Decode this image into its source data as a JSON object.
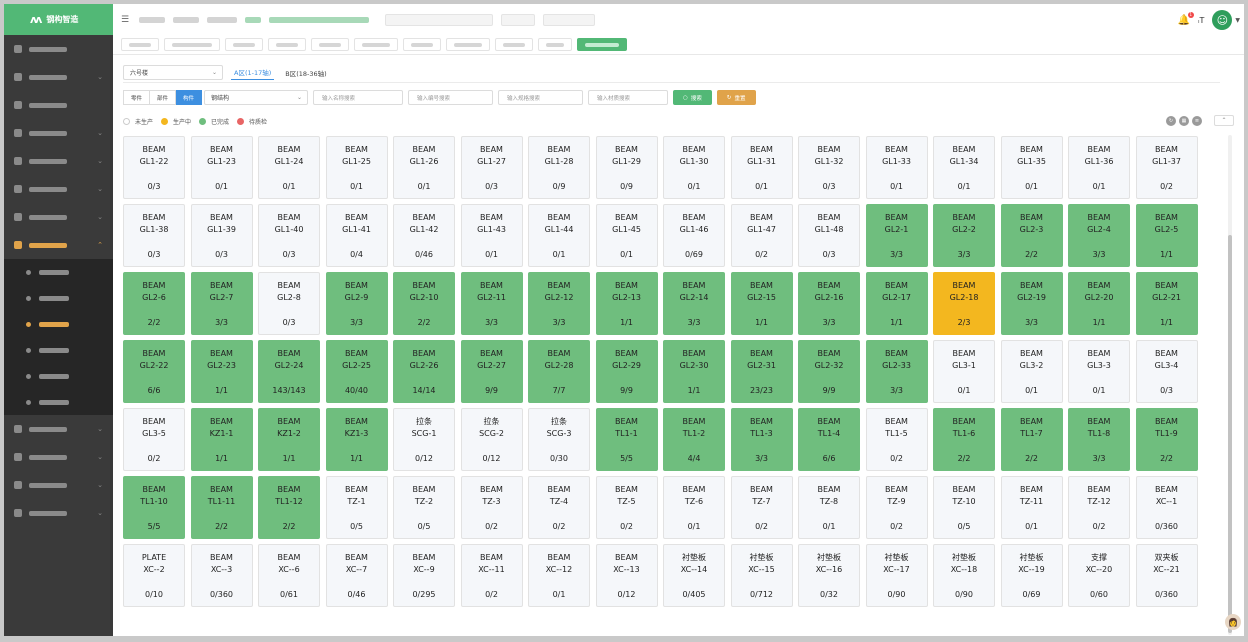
{
  "app": {
    "title": "钢构智造"
  },
  "header": {
    "notifications_count": "1",
    "text_size_label": "T"
  },
  "filters": {
    "building_select": "六号楼",
    "zones": [
      "A区(1-17轴)",
      "B区(18-36轴)"
    ],
    "active_zone": 0,
    "segments": [
      "零件",
      "部件",
      "构件"
    ],
    "active_segment": 2,
    "type_select": "钢结构",
    "inputs": [
      {
        "placeholder": "输入名称搜索"
      },
      {
        "placeholder": "输入编号搜索"
      },
      {
        "placeholder": "输入规格搜索"
      },
      {
        "placeholder": "输入材质搜索"
      }
    ],
    "search_button": "搜索",
    "reset_button": "重置"
  },
  "legend": [
    {
      "label": "未生产",
      "color": "#ffffff"
    },
    {
      "label": "生产中",
      "color": "#f3b71f"
    },
    {
      "label": "已完成",
      "color": "#6fbe7e"
    },
    {
      "label": "待质检",
      "color": "#e86565"
    }
  ],
  "colors": {
    "brand": "#52b876",
    "in_progress": "#f3b71f",
    "done": "#6fbe7e",
    "active_blue": "#3d8fe0"
  },
  "cells": [
    {
      "l1": "BEAM",
      "l2": "GL1-22",
      "count": "0/3",
      "status": "none"
    },
    {
      "l1": "BEAM",
      "l2": "GL1-23",
      "count": "0/1",
      "status": "none"
    },
    {
      "l1": "BEAM",
      "l2": "GL1-24",
      "count": "0/1",
      "status": "none"
    },
    {
      "l1": "BEAM",
      "l2": "GL1-25",
      "count": "0/1",
      "status": "none"
    },
    {
      "l1": "BEAM",
      "l2": "GL1-26",
      "count": "0/1",
      "status": "none"
    },
    {
      "l1": "BEAM",
      "l2": "GL1-27",
      "count": "0/3",
      "status": "none"
    },
    {
      "l1": "BEAM",
      "l2": "GL1-28",
      "count": "0/9",
      "status": "none"
    },
    {
      "l1": "BEAM",
      "l2": "GL1-29",
      "count": "0/9",
      "status": "none"
    },
    {
      "l1": "BEAM",
      "l2": "GL1-30",
      "count": "0/1",
      "status": "none"
    },
    {
      "l1": "BEAM",
      "l2": "GL1-31",
      "count": "0/1",
      "status": "none"
    },
    {
      "l1": "BEAM",
      "l2": "GL1-32",
      "count": "0/3",
      "status": "none"
    },
    {
      "l1": "BEAM",
      "l2": "GL1-33",
      "count": "0/1",
      "status": "none"
    },
    {
      "l1": "BEAM",
      "l2": "GL1-34",
      "count": "0/1",
      "status": "none"
    },
    {
      "l1": "BEAM",
      "l2": "GL1-35",
      "count": "0/1",
      "status": "none"
    },
    {
      "l1": "BEAM",
      "l2": "GL1-36",
      "count": "0/1",
      "status": "none"
    },
    {
      "l1": "BEAM",
      "l2": "GL1-37",
      "count": "0/2",
      "status": "none"
    },
    {
      "l1": "BEAM",
      "l2": "GL1-38",
      "count": "0/3",
      "status": "none"
    },
    {
      "l1": "BEAM",
      "l2": "GL1-39",
      "count": "0/3",
      "status": "none"
    },
    {
      "l1": "BEAM",
      "l2": "GL1-40",
      "count": "0/3",
      "status": "none"
    },
    {
      "l1": "BEAM",
      "l2": "GL1-41",
      "count": "0/4",
      "status": "none"
    },
    {
      "l1": "BEAM",
      "l2": "GL1-42",
      "count": "0/46",
      "status": "none"
    },
    {
      "l1": "BEAM",
      "l2": "GL1-43",
      "count": "0/1",
      "status": "none"
    },
    {
      "l1": "BEAM",
      "l2": "GL1-44",
      "count": "0/1",
      "status": "none"
    },
    {
      "l1": "BEAM",
      "l2": "GL1-45",
      "count": "0/1",
      "status": "none"
    },
    {
      "l1": "BEAM",
      "l2": "GL1-46",
      "count": "0/69",
      "status": "none"
    },
    {
      "l1": "BEAM",
      "l2": "GL1-47",
      "count": "0/2",
      "status": "none"
    },
    {
      "l1": "BEAM",
      "l2": "GL1-48",
      "count": "0/3",
      "status": "none"
    },
    {
      "l1": "BEAM",
      "l2": "GL2-1",
      "count": "3/3",
      "status": "done"
    },
    {
      "l1": "BEAM",
      "l2": "GL2-2",
      "count": "3/3",
      "status": "done"
    },
    {
      "l1": "BEAM",
      "l2": "GL2-3",
      "count": "2/2",
      "status": "done"
    },
    {
      "l1": "BEAM",
      "l2": "GL2-4",
      "count": "3/3",
      "status": "done"
    },
    {
      "l1": "BEAM",
      "l2": "GL2-5",
      "count": "1/1",
      "status": "done"
    },
    {
      "l1": "BEAM",
      "l2": "GL2-6",
      "count": "2/2",
      "status": "done"
    },
    {
      "l1": "BEAM",
      "l2": "GL2-7",
      "count": "3/3",
      "status": "done"
    },
    {
      "l1": "BEAM",
      "l2": "GL2-8",
      "count": "0/3",
      "status": "none"
    },
    {
      "l1": "BEAM",
      "l2": "GL2-9",
      "count": "3/3",
      "status": "done"
    },
    {
      "l1": "BEAM",
      "l2": "GL2-10",
      "count": "2/2",
      "status": "done"
    },
    {
      "l1": "BEAM",
      "l2": "GL2-11",
      "count": "3/3",
      "status": "done"
    },
    {
      "l1": "BEAM",
      "l2": "GL2-12",
      "count": "3/3",
      "status": "done"
    },
    {
      "l1": "BEAM",
      "l2": "GL2-13",
      "count": "1/1",
      "status": "done"
    },
    {
      "l1": "BEAM",
      "l2": "GL2-14",
      "count": "3/3",
      "status": "done"
    },
    {
      "l1": "BEAM",
      "l2": "GL2-15",
      "count": "1/1",
      "status": "done"
    },
    {
      "l1": "BEAM",
      "l2": "GL2-16",
      "count": "3/3",
      "status": "done"
    },
    {
      "l1": "BEAM",
      "l2": "GL2-17",
      "count": "1/1",
      "status": "done"
    },
    {
      "l1": "BEAM",
      "l2": "GL2-18",
      "count": "2/3",
      "status": "prog"
    },
    {
      "l1": "BEAM",
      "l2": "GL2-19",
      "count": "3/3",
      "status": "done"
    },
    {
      "l1": "BEAM",
      "l2": "GL2-20",
      "count": "1/1",
      "status": "done"
    },
    {
      "l1": "BEAM",
      "l2": "GL2-21",
      "count": "1/1",
      "status": "done"
    },
    {
      "l1": "BEAM",
      "l2": "GL2-22",
      "count": "6/6",
      "status": "done"
    },
    {
      "l1": "BEAM",
      "l2": "GL2-23",
      "count": "1/1",
      "status": "done"
    },
    {
      "l1": "BEAM",
      "l2": "GL2-24",
      "count": "143/143",
      "status": "done"
    },
    {
      "l1": "BEAM",
      "l2": "GL2-25",
      "count": "40/40",
      "status": "done"
    },
    {
      "l1": "BEAM",
      "l2": "GL2-26",
      "count": "14/14",
      "status": "done"
    },
    {
      "l1": "BEAM",
      "l2": "GL2-27",
      "count": "9/9",
      "status": "done"
    },
    {
      "l1": "BEAM",
      "l2": "GL2-28",
      "count": "7/7",
      "status": "done"
    },
    {
      "l1": "BEAM",
      "l2": "GL2-29",
      "count": "9/9",
      "status": "done"
    },
    {
      "l1": "BEAM",
      "l2": "GL2-30",
      "count": "1/1",
      "status": "done"
    },
    {
      "l1": "BEAM",
      "l2": "GL2-31",
      "count": "23/23",
      "status": "done"
    },
    {
      "l1": "BEAM",
      "l2": "GL2-32",
      "count": "9/9",
      "status": "done"
    },
    {
      "l1": "BEAM",
      "l2": "GL2-33",
      "count": "3/3",
      "status": "done"
    },
    {
      "l1": "BEAM",
      "l2": "GL3-1",
      "count": "0/1",
      "status": "none"
    },
    {
      "l1": "BEAM",
      "l2": "GL3-2",
      "count": "0/1",
      "status": "none"
    },
    {
      "l1": "BEAM",
      "l2": "GL3-3",
      "count": "0/1",
      "status": "none"
    },
    {
      "l1": "BEAM",
      "l2": "GL3-4",
      "count": "0/3",
      "status": "none"
    },
    {
      "l1": "BEAM",
      "l2": "GL3-5",
      "count": "0/2",
      "status": "none"
    },
    {
      "l1": "BEAM",
      "l2": "KZ1-1",
      "count": "1/1",
      "status": "done"
    },
    {
      "l1": "BEAM",
      "l2": "KZ1-2",
      "count": "1/1",
      "status": "done"
    },
    {
      "l1": "BEAM",
      "l2": "KZ1-3",
      "count": "1/1",
      "status": "done"
    },
    {
      "l1": "拉条",
      "l2": "SCG-1",
      "count": "0/12",
      "status": "none"
    },
    {
      "l1": "拉条",
      "l2": "SCG-2",
      "count": "0/12",
      "status": "none"
    },
    {
      "l1": "拉条",
      "l2": "SCG-3",
      "count": "0/30",
      "status": "none"
    },
    {
      "l1": "BEAM",
      "l2": "TL1-1",
      "count": "5/5",
      "status": "done"
    },
    {
      "l1": "BEAM",
      "l2": "TL1-2",
      "count": "4/4",
      "status": "done"
    },
    {
      "l1": "BEAM",
      "l2": "TL1-3",
      "count": "3/3",
      "status": "done"
    },
    {
      "l1": "BEAM",
      "l2": "TL1-4",
      "count": "6/6",
      "status": "done"
    },
    {
      "l1": "BEAM",
      "l2": "TL1-5",
      "count": "0/2",
      "status": "none"
    },
    {
      "l1": "BEAM",
      "l2": "TL1-6",
      "count": "2/2",
      "status": "done"
    },
    {
      "l1": "BEAM",
      "l2": "TL1-7",
      "count": "2/2",
      "status": "done"
    },
    {
      "l1": "BEAM",
      "l2": "TL1-8",
      "count": "3/3",
      "status": "done"
    },
    {
      "l1": "BEAM",
      "l2": "TL1-9",
      "count": "2/2",
      "status": "done"
    },
    {
      "l1": "BEAM",
      "l2": "TL1-10",
      "count": "5/5",
      "status": "done"
    },
    {
      "l1": "BEAM",
      "l2": "TL1-11",
      "count": "2/2",
      "status": "done"
    },
    {
      "l1": "BEAM",
      "l2": "TL1-12",
      "count": "2/2",
      "status": "done"
    },
    {
      "l1": "BEAM",
      "l2": "TZ-1",
      "count": "0/5",
      "status": "none"
    },
    {
      "l1": "BEAM",
      "l2": "TZ-2",
      "count": "0/5",
      "status": "none"
    },
    {
      "l1": "BEAM",
      "l2": "TZ-3",
      "count": "0/2",
      "status": "none"
    },
    {
      "l1": "BEAM",
      "l2": "TZ-4",
      "count": "0/2",
      "status": "none"
    },
    {
      "l1": "BEAM",
      "l2": "TZ-5",
      "count": "0/2",
      "status": "none"
    },
    {
      "l1": "BEAM",
      "l2": "TZ-6",
      "count": "0/1",
      "status": "none"
    },
    {
      "l1": "BEAM",
      "l2": "TZ-7",
      "count": "0/2",
      "status": "none"
    },
    {
      "l1": "BEAM",
      "l2": "TZ-8",
      "count": "0/1",
      "status": "none"
    },
    {
      "l1": "BEAM",
      "l2": "TZ-9",
      "count": "0/2",
      "status": "none"
    },
    {
      "l1": "BEAM",
      "l2": "TZ-10",
      "count": "0/5",
      "status": "none"
    },
    {
      "l1": "BEAM",
      "l2": "TZ-11",
      "count": "0/1",
      "status": "none"
    },
    {
      "l1": "BEAM",
      "l2": "TZ-12",
      "count": "0/2",
      "status": "none"
    },
    {
      "l1": "BEAM",
      "l2": "XC--1",
      "count": "0/360",
      "status": "none"
    },
    {
      "l1": "PLATE",
      "l2": "XC--2",
      "count": "0/10",
      "status": "none"
    },
    {
      "l1": "BEAM",
      "l2": "XC--3",
      "count": "0/360",
      "status": "none"
    },
    {
      "l1": "BEAM",
      "l2": "XC--6",
      "count": "0/61",
      "status": "none"
    },
    {
      "l1": "BEAM",
      "l2": "XC--7",
      "count": "0/46",
      "status": "none"
    },
    {
      "l1": "BEAM",
      "l2": "XC--9",
      "count": "0/295",
      "status": "none"
    },
    {
      "l1": "BEAM",
      "l2": "XC--11",
      "count": "0/2",
      "status": "none"
    },
    {
      "l1": "BEAM",
      "l2": "XC--12",
      "count": "0/1",
      "status": "none"
    },
    {
      "l1": "BEAM",
      "l2": "XC--13",
      "count": "0/12",
      "status": "none"
    },
    {
      "l1": "衬垫板",
      "l2": "XC--14",
      "count": "0/405",
      "status": "none"
    },
    {
      "l1": "衬垫板",
      "l2": "XC--15",
      "count": "0/712",
      "status": "none"
    },
    {
      "l1": "衬垫板",
      "l2": "XC--16",
      "count": "0/32",
      "status": "none"
    },
    {
      "l1": "衬垫板",
      "l2": "XC--17",
      "count": "0/90",
      "status": "none"
    },
    {
      "l1": "衬垫板",
      "l2": "XC--18",
      "count": "0/90",
      "status": "none"
    },
    {
      "l1": "衬垫板",
      "l2": "XC--19",
      "count": "0/69",
      "status": "none"
    },
    {
      "l1": "支撑",
      "l2": "XC--20",
      "count": "0/60",
      "status": "none"
    },
    {
      "l1": "双夹板",
      "l2": "XC--21",
      "count": "0/360",
      "status": "none"
    }
  ]
}
